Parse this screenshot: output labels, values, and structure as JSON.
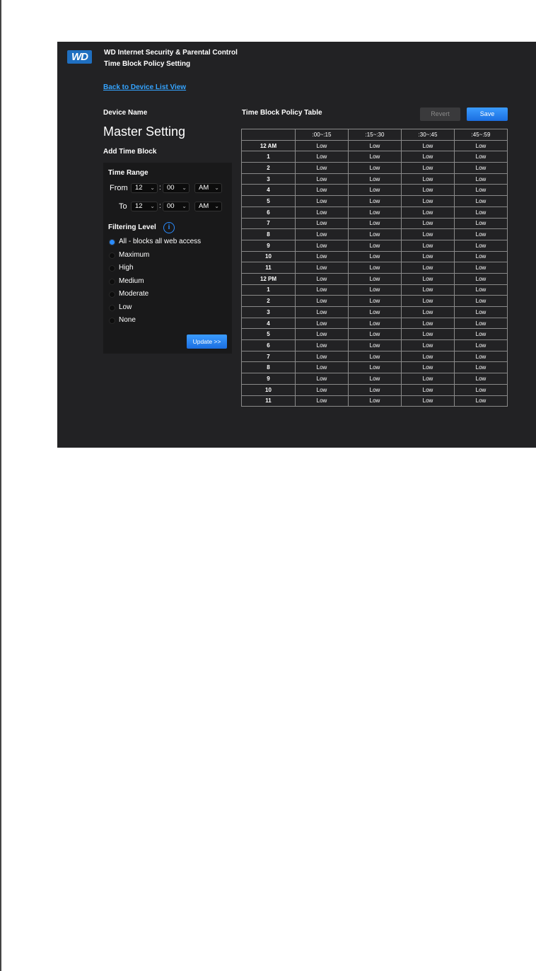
{
  "header": {
    "logo": "WD",
    "title": "WD Internet Security & Parental Control",
    "subtitle": "Time Block Policy Setting"
  },
  "back_link": "Back to Device List View",
  "device": {
    "label": "Device Name",
    "name": "Master Setting"
  },
  "add_time_block": {
    "title": "Add Time Block",
    "time_range_label": "Time Range",
    "from_label": "From",
    "to_label": "To",
    "from": {
      "hour": "12",
      "minute": "00",
      "ampm": "AM"
    },
    "to": {
      "hour": "12",
      "minute": "00",
      "ampm": "AM"
    },
    "colon": ":",
    "filtering_level_label": "Filtering Level",
    "filtering_options": [
      {
        "label": "All - blocks all web access",
        "checked": true
      },
      {
        "label": "Maximum",
        "checked": false
      },
      {
        "label": "High",
        "checked": false
      },
      {
        "label": "Medium",
        "checked": false
      },
      {
        "label": "Moderate",
        "checked": false
      },
      {
        "label": "Low",
        "checked": false
      },
      {
        "label": "None",
        "checked": false
      }
    ],
    "update_button": "Update >>"
  },
  "policy_table": {
    "title": "Time Block Policy Table",
    "revert_button": "Revert",
    "save_button": "Save",
    "columns": [
      "",
      ":00~:15",
      ":15~:30",
      ":30~:45",
      ":45~:59"
    ],
    "rows": [
      {
        "hour": "12 AM",
        "values": [
          "Low",
          "Low",
          "Low",
          "Low"
        ]
      },
      {
        "hour": "1",
        "values": [
          "Low",
          "Low",
          "Low",
          "Low"
        ]
      },
      {
        "hour": "2",
        "values": [
          "Low",
          "Low",
          "Low",
          "Low"
        ]
      },
      {
        "hour": "3",
        "values": [
          "Low",
          "Low",
          "Low",
          "Low"
        ]
      },
      {
        "hour": "4",
        "values": [
          "Low",
          "Low",
          "Low",
          "Low"
        ]
      },
      {
        "hour": "5",
        "values": [
          "Low",
          "Low",
          "Low",
          "Low"
        ]
      },
      {
        "hour": "6",
        "values": [
          "Low",
          "Low",
          "Low",
          "Low"
        ]
      },
      {
        "hour": "7",
        "values": [
          "Low",
          "Low",
          "Low",
          "Low"
        ]
      },
      {
        "hour": "8",
        "values": [
          "Low",
          "Low",
          "Low",
          "Low"
        ]
      },
      {
        "hour": "9",
        "values": [
          "Low",
          "Low",
          "Low",
          "Low"
        ]
      },
      {
        "hour": "10",
        "values": [
          "Low",
          "Low",
          "Low",
          "Low"
        ]
      },
      {
        "hour": "11",
        "values": [
          "Low",
          "Low",
          "Low",
          "Low"
        ]
      },
      {
        "hour": "12 PM",
        "values": [
          "Low",
          "Low",
          "Low",
          "Low"
        ]
      },
      {
        "hour": "1",
        "values": [
          "Low",
          "Low",
          "Low",
          "Low"
        ]
      },
      {
        "hour": "2",
        "values": [
          "Low",
          "Low",
          "Low",
          "Low"
        ]
      },
      {
        "hour": "3",
        "values": [
          "Low",
          "Low",
          "Low",
          "Low"
        ]
      },
      {
        "hour": "4",
        "values": [
          "Low",
          "Low",
          "Low",
          "Low"
        ]
      },
      {
        "hour": "5",
        "values": [
          "Low",
          "Low",
          "Low",
          "Low"
        ]
      },
      {
        "hour": "6",
        "values": [
          "Low",
          "Low",
          "Low",
          "Low"
        ]
      },
      {
        "hour": "7",
        "values": [
          "Low",
          "Low",
          "Low",
          "Low"
        ]
      },
      {
        "hour": "8",
        "values": [
          "Low",
          "Low",
          "Low",
          "Low"
        ]
      },
      {
        "hour": "9",
        "values": [
          "Low",
          "Low",
          "Low",
          "Low"
        ]
      },
      {
        "hour": "10",
        "values": [
          "Low",
          "Low",
          "Low",
          "Low"
        ]
      },
      {
        "hour": "11",
        "values": [
          "Low",
          "Low",
          "Low",
          "Low"
        ]
      }
    ]
  },
  "icons": {
    "chevron": "chevron-down-icon",
    "info": "info-icon"
  },
  "colors": {
    "background": "#222224",
    "accent": "#2a8cff",
    "link": "#35a4ff"
  }
}
